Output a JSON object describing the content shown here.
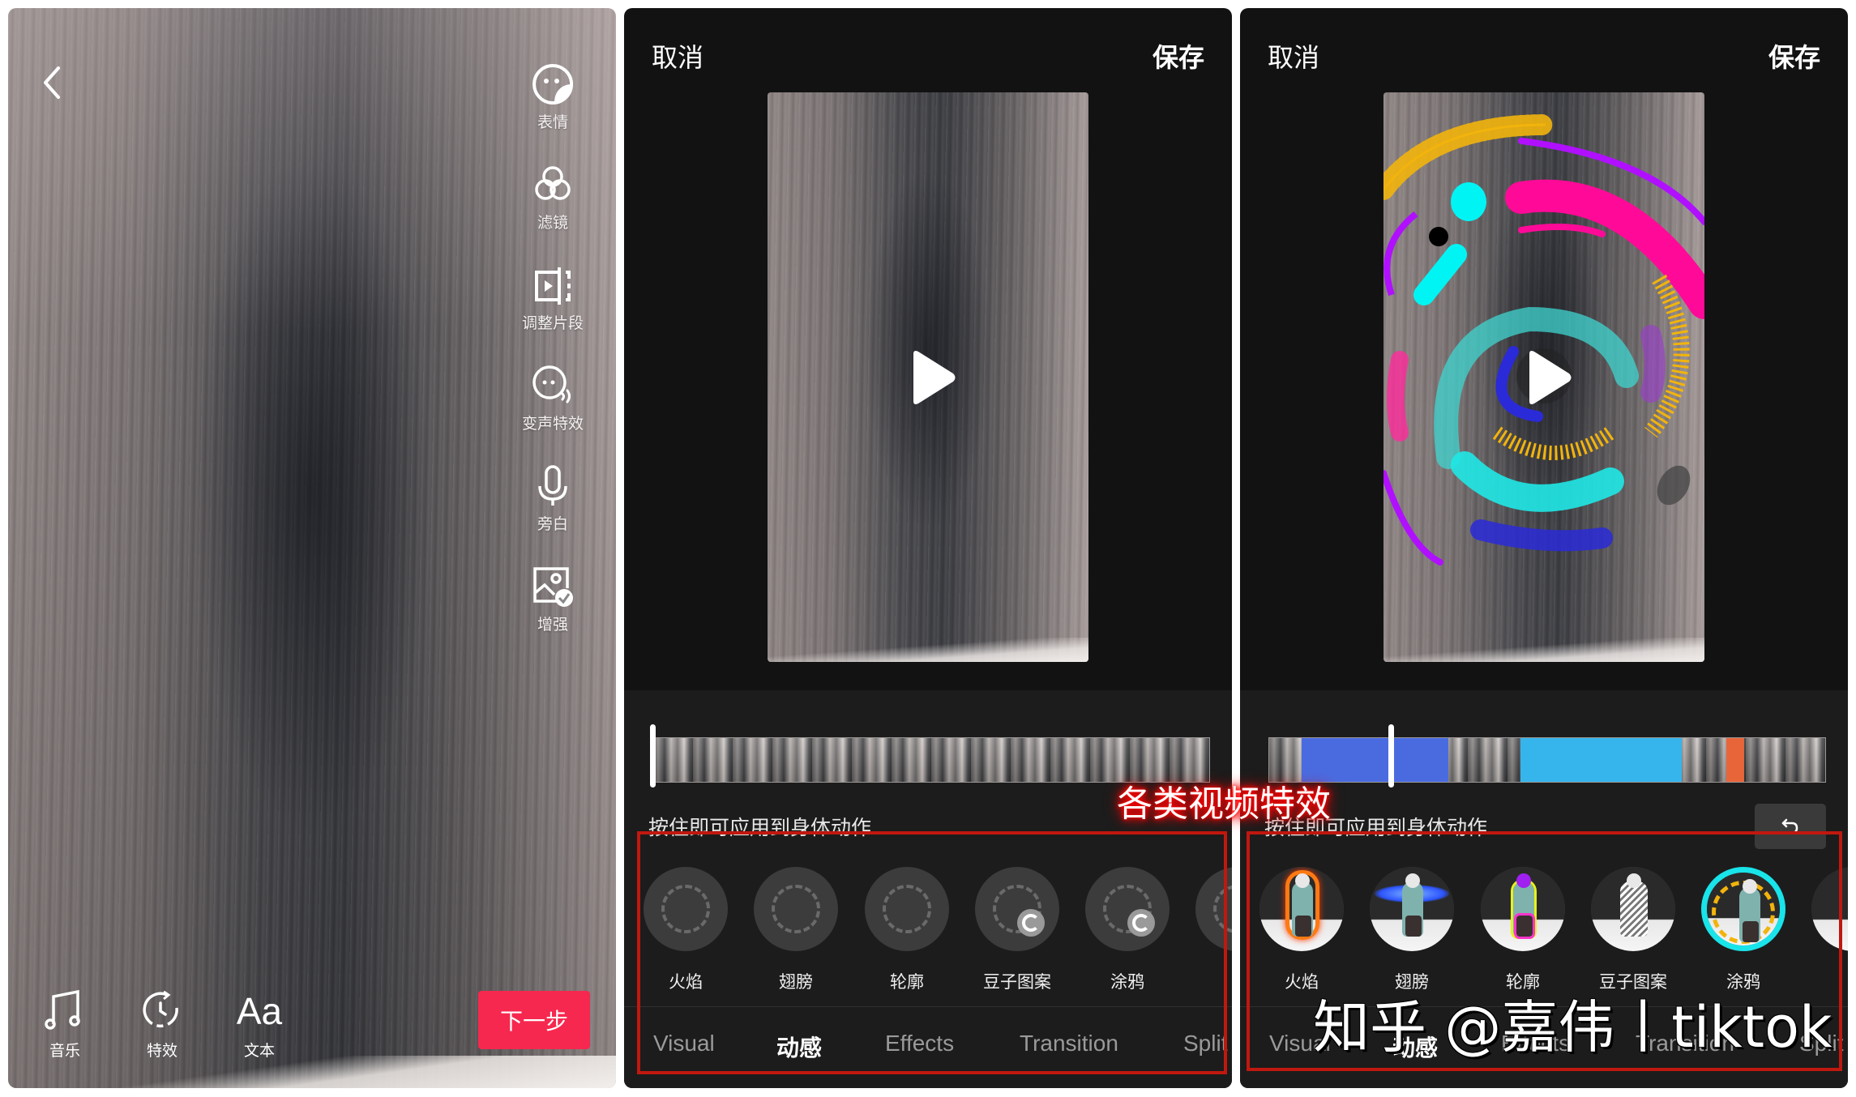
{
  "camera_screen": {
    "back_icon": "chevron-left-icon",
    "side_tools": [
      {
        "icon": "sticker-face-icon",
        "label": "表情"
      },
      {
        "icon": "filter-circles-icon",
        "label": "滤镜"
      },
      {
        "icon": "adjust-clip-icon",
        "label": "调整片段"
      },
      {
        "icon": "voice-effect-icon",
        "label": "变声特效"
      },
      {
        "icon": "microphone-icon",
        "label": "旁白"
      },
      {
        "icon": "enhance-image-icon",
        "label": "增强"
      }
    ],
    "bottom_tools": [
      {
        "icon": "music-note-icon",
        "label": "音乐"
      },
      {
        "icon": "effects-timer-icon",
        "label": "特效"
      },
      {
        "icon": "text-icon",
        "glyph": "Aa",
        "label": "文本"
      }
    ],
    "next_button": "下一步",
    "accent_color": "#f6284f"
  },
  "editor_before": {
    "cancel": "取消",
    "save": "保存",
    "hint": "按住即可应用到身体动作",
    "playhead_position": 0.0,
    "effects": [
      {
        "label": "火焰",
        "state": "placeholder"
      },
      {
        "label": "翅膀",
        "state": "placeholder"
      },
      {
        "label": "轮廓",
        "state": "placeholder"
      },
      {
        "label": "豆子图案",
        "state": "downloading"
      },
      {
        "label": "涂鸦",
        "state": "downloading"
      }
    ],
    "tabs": [
      {
        "label": "Visual",
        "active": false
      },
      {
        "label": "动感",
        "active": true
      },
      {
        "label": "Effects",
        "active": false
      },
      {
        "label": "Transition",
        "active": false
      },
      {
        "label": "Split",
        "active": false
      }
    ]
  },
  "editor_after": {
    "cancel": "取消",
    "save": "保存",
    "hint": "按住即可应用到身体动作",
    "undo_icon": "undo-arrow-icon",
    "playhead_position": 0.22,
    "applied_segments": [
      {
        "start": 0.058,
        "end": 0.322,
        "color": "#4a6be0"
      },
      {
        "start": 0.452,
        "end": 0.742,
        "color": "#36b4ec"
      },
      {
        "start": 0.822,
        "end": 0.854,
        "color": "#e8653a"
      }
    ],
    "effects": [
      {
        "label": "火焰",
        "state": "ready",
        "selected": false
      },
      {
        "label": "翅膀",
        "state": "ready",
        "selected": false
      },
      {
        "label": "轮廓",
        "state": "ready",
        "selected": false
      },
      {
        "label": "豆子图案",
        "state": "ready",
        "selected": false
      },
      {
        "label": "涂鸦",
        "state": "ready",
        "selected": true
      }
    ],
    "tabs": [
      {
        "label": "Visual",
        "active": false
      },
      {
        "label": "动感",
        "active": true
      },
      {
        "label": "Effects",
        "active": false
      },
      {
        "label": "Transition",
        "active": false
      },
      {
        "label": "Split",
        "active": false
      }
    ]
  },
  "annotation": {
    "label": "各类视频特效",
    "box_color": "#c0180f"
  },
  "watermark": "知乎 @嘉伟丨tiktok"
}
